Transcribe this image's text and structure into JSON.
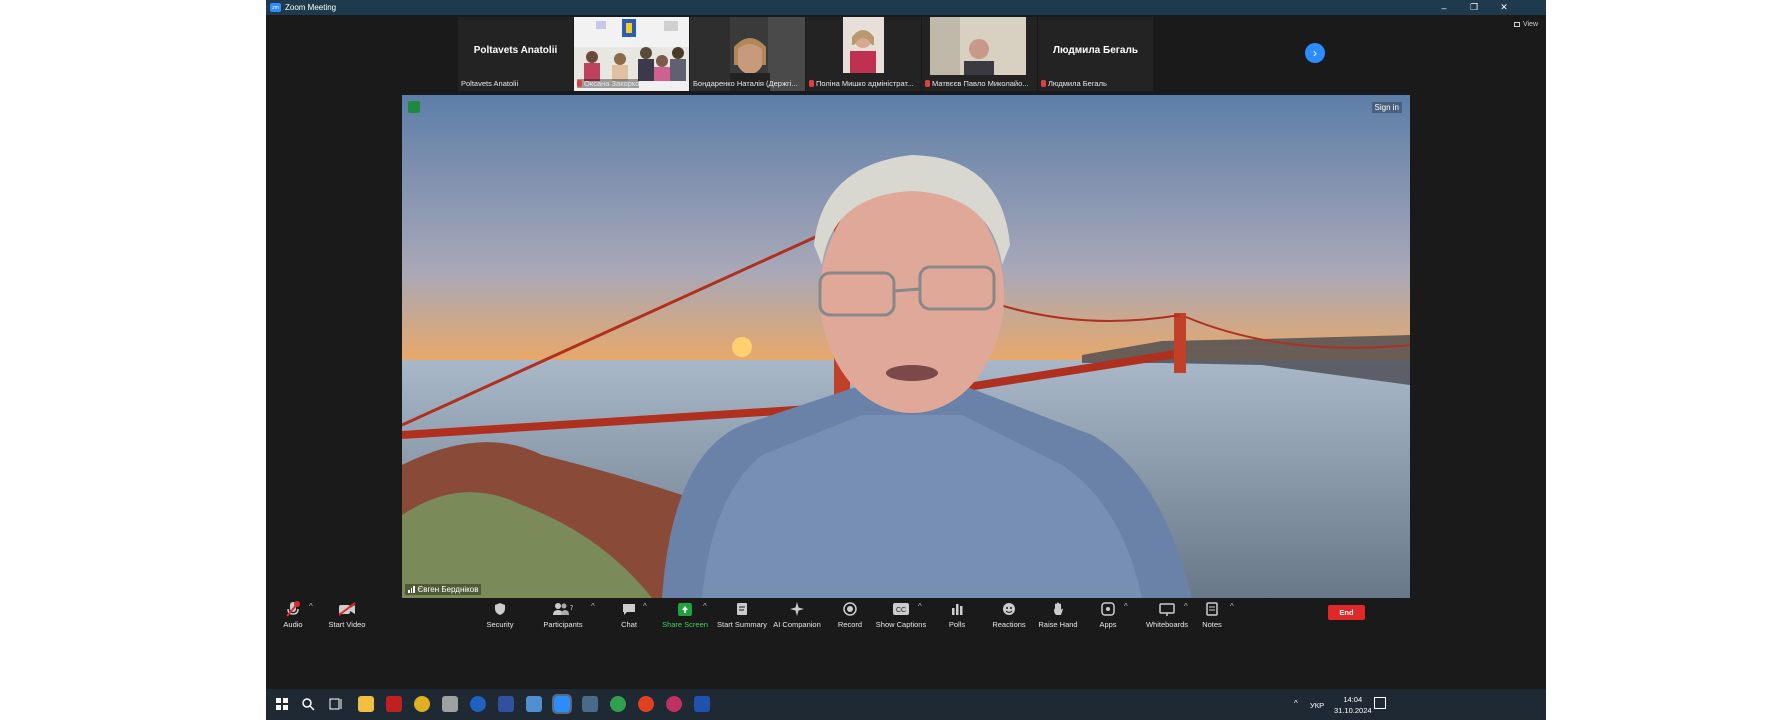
{
  "window": {
    "title": "Zoom Meeting",
    "controls": [
      "–",
      "❐",
      "✕"
    ]
  },
  "view": {
    "label": "View"
  },
  "strip": {
    "tiles": [
      {
        "name": "Poltavets Anatolii",
        "center_name": "Poltavets Anatolii",
        "muted": false
      },
      {
        "name": "Оксана Закорко",
        "muted": true
      },
      {
        "name": "Бондаренко Наталія (Держгі...",
        "muted": false
      },
      {
        "name": "Поліна Мишко адміністрат...",
        "muted": true
      },
      {
        "name": "Матвєєв Павло Миколайо...",
        "muted": true
      },
      {
        "name": "Людмила Бегаль",
        "center_name": "Людмила Бегаль",
        "muted": true
      }
    ],
    "next_icon": "chevron-right-icon"
  },
  "main": {
    "speaker": "Євген Бердніков",
    "sign_in": "Sign in",
    "shield_color": "#1f8a3c"
  },
  "toolbar": {
    "items": [
      {
        "label": "Audio",
        "icon": "microphone-muted-icon"
      },
      {
        "label": "Start Video",
        "icon": "video-off-icon"
      },
      {
        "label": "Security",
        "icon": "shield-icon"
      },
      {
        "label": "Participants",
        "icon": "participants-icon",
        "count": "7"
      },
      {
        "label": "Chat",
        "icon": "chat-icon"
      },
      {
        "label": "Share Screen",
        "icon": "share-screen-icon"
      },
      {
        "label": "Start Summary",
        "icon": "summary-icon"
      },
      {
        "label": "AI Companion",
        "icon": "sparkle-icon"
      },
      {
        "label": "Record",
        "icon": "record-icon"
      },
      {
        "label": "Show Captions",
        "icon": "cc-icon"
      },
      {
        "label": "Polls",
        "icon": "polls-icon"
      },
      {
        "label": "Reactions",
        "icon": "reactions-icon"
      },
      {
        "label": "Raise Hand",
        "icon": "hand-icon"
      },
      {
        "label": "Apps",
        "icon": "apps-icon"
      },
      {
        "label": "Whiteboards",
        "icon": "whiteboard-icon"
      },
      {
        "label": "Notes",
        "icon": "notes-icon"
      }
    ],
    "end_label": "End",
    "audio_badge": "1"
  },
  "colors": {
    "accent": "#2d8cff",
    "share": "#1fa33c",
    "end": "#e02828"
  },
  "taskbar": {
    "language": "УКР",
    "time": "14:04",
    "date": "31.10.2024"
  }
}
